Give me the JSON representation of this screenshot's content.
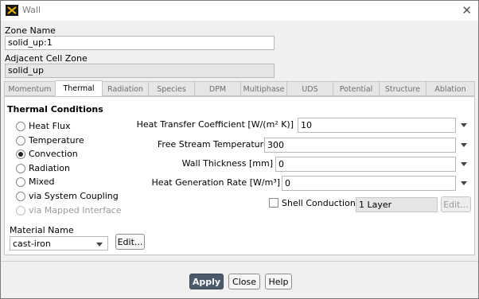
{
  "window": {
    "title": "Wall"
  },
  "zone": {
    "label": "Zone Name",
    "value": "solid_up:1"
  },
  "adjacent": {
    "label": "Adjacent Cell Zone",
    "value": "solid_up"
  },
  "tabs": [
    {
      "label": "Momentum"
    },
    {
      "label": "Thermal"
    },
    {
      "label": "Radiation"
    },
    {
      "label": "Species"
    },
    {
      "label": "DPM"
    },
    {
      "label": "Multiphase"
    },
    {
      "label": "UDS"
    },
    {
      "label": "Potential"
    },
    {
      "label": "Structure"
    },
    {
      "label": "Ablation"
    }
  ],
  "active_tab": "Thermal",
  "thermal": {
    "title": "Thermal Conditions",
    "options": [
      {
        "label": "Heat Flux",
        "selected": false,
        "disabled": false
      },
      {
        "label": "Temperature",
        "selected": false,
        "disabled": false
      },
      {
        "label": "Convection",
        "selected": true,
        "disabled": false
      },
      {
        "label": "Radiation",
        "selected": false,
        "disabled": false
      },
      {
        "label": "Mixed",
        "selected": false,
        "disabled": false
      },
      {
        "label": "via System Coupling",
        "selected": false,
        "disabled": false
      },
      {
        "label": "via Mapped Interface",
        "selected": false,
        "disabled": true
      }
    ],
    "fields": [
      {
        "label": "Heat Transfer Coefficient [W/(m² K)]",
        "value": "10"
      },
      {
        "label": "Free Stream Temperature [K]",
        "value": "300"
      },
      {
        "label": "Wall Thickness [mm]",
        "value": "0"
      },
      {
        "label": "Heat Generation Rate [W/m³]",
        "value": "0"
      }
    ],
    "shell": {
      "label": "Shell Conduction",
      "checked": false,
      "layers": "1 Layer",
      "edit_label": "Edit..."
    }
  },
  "material": {
    "label": "Material Name",
    "value": "cast-iron",
    "edit_label": "Edit..."
  },
  "footer": {
    "apply": "Apply",
    "close": "Close",
    "help": "Help"
  }
}
